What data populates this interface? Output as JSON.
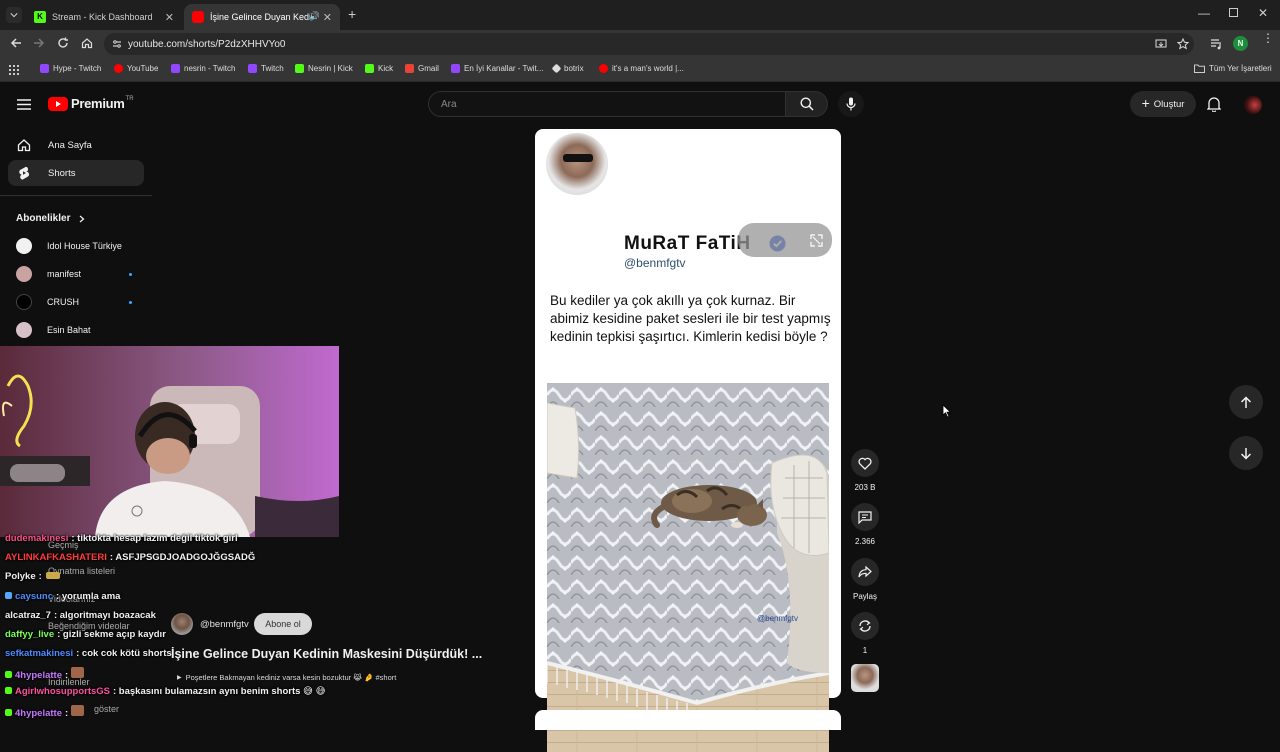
{
  "browser": {
    "tabs": [
      {
        "label": "Stream - Kick Dashboard",
        "color": "#53fc18"
      },
      {
        "label": "İşine Gelince Duyan Kedinin",
        "color": "#ff0000"
      }
    ],
    "url": "youtube.com/shorts/P2dzXHHVYo0",
    "profile_initial": "N",
    "bookmarks": [
      {
        "label": "Hype - Twitch",
        "color": "#9146ff"
      },
      {
        "label": "YouTube",
        "color": "#ff0000"
      },
      {
        "label": "nesrin - Twitch",
        "color": "#9146ff"
      },
      {
        "label": "Twitch",
        "color": "#9146ff"
      },
      {
        "label": "Nesrin | Kick",
        "color": "#53fc18"
      },
      {
        "label": "Kick",
        "color": "#53fc18"
      },
      {
        "label": "Gmail",
        "color": "#ea4335"
      },
      {
        "label": "En İyi Kanallar - Twit...",
        "color": "#9146ff"
      },
      {
        "label": "botrix",
        "color": "#dddddd"
      },
      {
        "label": "it's a man's world |...",
        "color": "#ff0000"
      }
    ],
    "all_bookmarks": "Tüm Yer İşaretleri"
  },
  "youtube": {
    "logo": "Premium",
    "logo_suffix": "TR",
    "search_placeholder": "Ara",
    "create_label": "Oluştur",
    "nav": [
      {
        "label": "Ana Sayfa",
        "icon": "home-icon"
      },
      {
        "label": "Shorts",
        "icon": "shorts-icon"
      }
    ],
    "subscriptions_heading": "Abonelikler",
    "subscriptions": [
      {
        "label": "Idol House Türkiye",
        "color": "#f1f1f1",
        "new": false
      },
      {
        "label": "manifest",
        "color": "#c9a2a2",
        "new": true
      },
      {
        "label": "CRUSH",
        "color": "#000000",
        "new": true
      },
      {
        "label": "Esin Bahat",
        "color": "#d8c0c8",
        "new": false
      }
    ]
  },
  "short": {
    "author": "MuRaT FaTiH",
    "handle": "@benmfgtv",
    "text": "Bu kediler ya çok akıllı ya çok kurnaz. Bir abimiz kesidine paket sesleri ile bir test yapmış kedinin tepkisi şaşırtıcı. Kimlerin kedisi böyle ?",
    "watermark": "@benmfgtv",
    "channel": "@benmfgtv",
    "subscribe": "Abone ol",
    "title": "İşine Gelince Duyan Kedinin Maskesini Düşürdük! ...",
    "description": "Poşetlere Bakmayan kediniz varsa kesin bozuktur 😹 🤌 #short",
    "likes": "203 B",
    "comments": "2.366",
    "share": "Paylaş",
    "remix": "1"
  },
  "ghost_menu": [
    "Geçmiş",
    "Oynatma listeleri",
    "Videolarınız",
    "Beğendiğim videolar",
    "İndirilenler",
    "göster"
  ],
  "chat": [
    {
      "user": "dudemakinesi",
      "text": ": tiktokta hesap lazım değil tiktok girl",
      "color": "#ff4f8b"
    },
    {
      "user": "AYLINKAFKASHATERI",
      "text": ": ASFJPSGDJOADGOJĞGSADĞ",
      "color": "#ff3b3b"
    },
    {
      "user": "Polyke",
      "text": ":",
      "color": "#f1f1f1"
    },
    {
      "user": "caysunc",
      "text": ": yorumla ama",
      "color": "#4d8bff"
    },
    {
      "user": "alcatraz_7",
      "text": ": algoritmayı boazacak",
      "color": "#f1f1f1"
    },
    {
      "user": "daffyy_live",
      "text": ": gizli sekme açıp kaydır",
      "color": "#7cff5a"
    },
    {
      "user": "sefkatmakinesi",
      "text": ": cok cok kötü shorts",
      "color": "#4d8bff"
    },
    {
      "user": "4hypelatte",
      "text": ":",
      "color": "#c678ff"
    },
    {
      "user": "AgirlwhosupportsGS",
      "text": ": başkasını bulamazsın aynı benim shorts 😅 😅",
      "color": "#ff4fa0"
    },
    {
      "user": "4hypelatte",
      "text": ":",
      "color": "#c678ff"
    }
  ]
}
